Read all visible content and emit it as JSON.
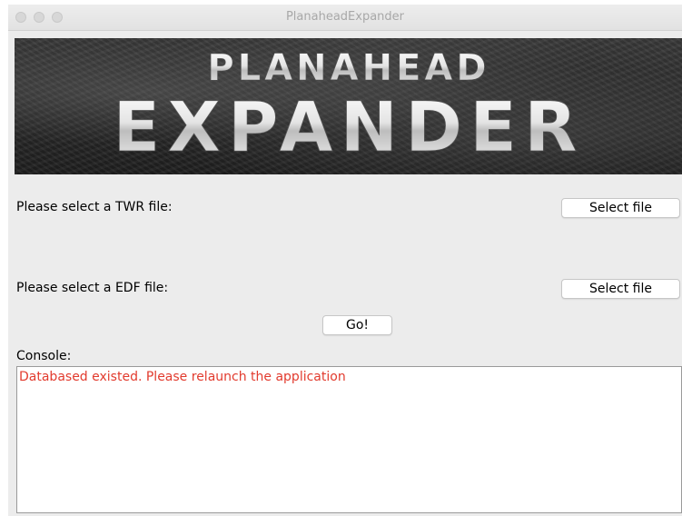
{
  "window": {
    "title": "PlanaheadExpander"
  },
  "banner": {
    "line1": "PLANAHEAD",
    "line2": "EXPANDER"
  },
  "twr": {
    "label": "Please select a TWR file:",
    "button_label": "Select file"
  },
  "edf": {
    "label": "Please select a EDF file:",
    "button_label": "Select file"
  },
  "go": {
    "button_label": "Go!"
  },
  "console": {
    "label": "Console:",
    "message": "Databased existed. Please relaunch the application",
    "message_color": "#e23b2e"
  }
}
